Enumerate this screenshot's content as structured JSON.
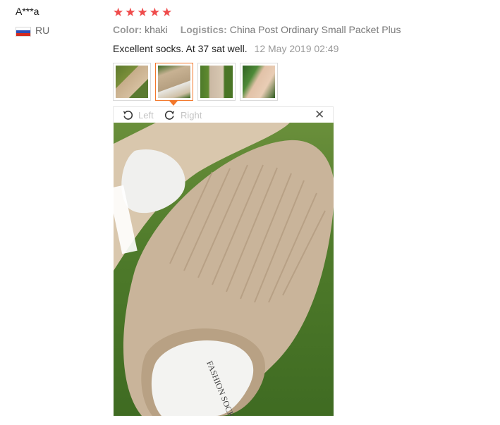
{
  "reviewer": {
    "name": "A***a",
    "country": "RU"
  },
  "review": {
    "rating_value": 5,
    "rating_max": 5,
    "attributes": [
      {
        "key": "Color:",
        "value": "khaki"
      },
      {
        "key": "Logistics:",
        "value": "China Post Ordinary Small Packet Plus"
      }
    ],
    "text": "Excellent socks. At 37 sat well.",
    "date": "12 May 2019 02:49"
  },
  "gallery": {
    "thumbnails": [
      "sock-photo-1",
      "sock-photo-2",
      "sock-photo-3",
      "sock-photo-4"
    ],
    "active_index": 1
  },
  "viewer": {
    "rotate_left_label": "Left",
    "rotate_right_label": "Right",
    "close_icon": "close-icon",
    "image_text": "FASHION SOCKS"
  },
  "colors": {
    "star": "#ef4c4c",
    "active_border": "#f3782c",
    "sock": "#c9b49a",
    "grass": "#4e7a2a"
  }
}
